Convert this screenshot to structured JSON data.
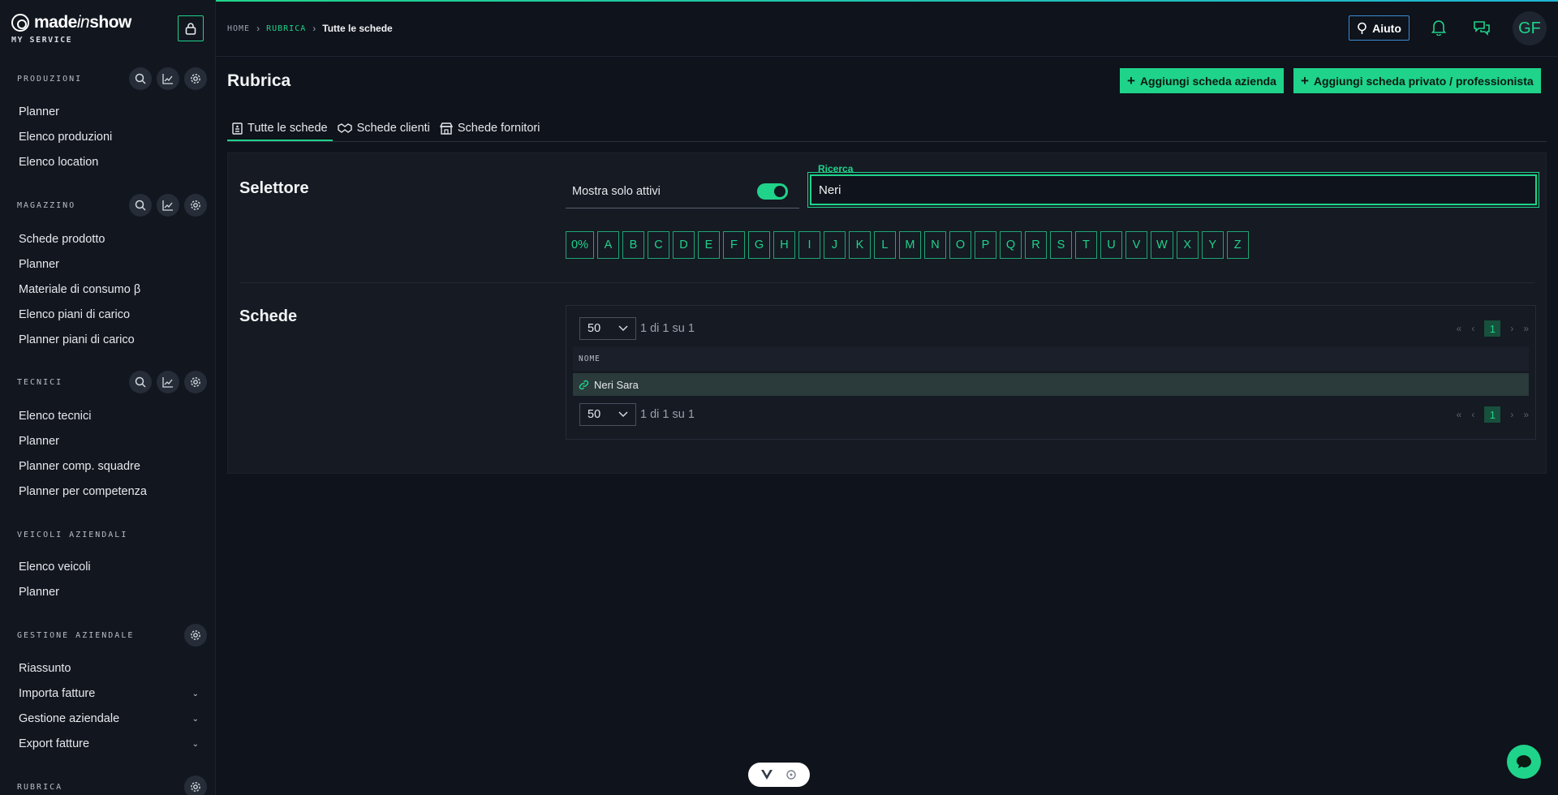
{
  "brand": {
    "name_prefix": "made",
    "name_italic": "in",
    "name_suffix": "show",
    "subtitle": "MY SERVICE"
  },
  "sidebar": {
    "sections": [
      {
        "title": "PRODUZIONI",
        "items": [
          "Planner",
          "Elenco produzioni",
          "Elenco location"
        ]
      },
      {
        "title": "MAGAZZINO",
        "items": [
          "Schede prodotto",
          "Planner",
          "Materiale di consumo β",
          "Elenco piani di carico",
          "Planner piani di carico"
        ]
      },
      {
        "title": "TECNICI",
        "items": [
          "Elenco tecnici",
          "Planner",
          "Planner comp. squadre",
          "Planner per competenza"
        ]
      },
      {
        "title": "VEICOLI AZIENDALI",
        "items": [
          "Elenco veicoli",
          "Planner"
        ]
      },
      {
        "title": "GESTIONE AZIENDALE",
        "items": [
          "Riassunto",
          "Importa fatture",
          "Gestione aziendale",
          "Export fatture"
        ]
      },
      {
        "title": "RUBRICA",
        "items": []
      }
    ]
  },
  "header": {
    "breadcrumb": {
      "home": "HOME",
      "section": "RUBRICA",
      "current": "Tutte le schede"
    },
    "help_label": "Aiuto",
    "avatar_initials": "GF"
  },
  "page": {
    "title": "Rubrica",
    "actions": {
      "add_company": "Aggiungi scheda azienda",
      "add_private": "Aggiungi scheda privato / professionista"
    },
    "tabs": [
      "Tutte le schede",
      "Schede clienti",
      "Schede fornitori"
    ]
  },
  "selector": {
    "title": "Selettore",
    "toggle_label": "Mostra solo attivi",
    "toggle_on": true,
    "search_label": "Ricerca",
    "search_value": "Neri",
    "letters": [
      "0%",
      "A",
      "B",
      "C",
      "D",
      "E",
      "F",
      "G",
      "H",
      "I",
      "J",
      "K",
      "L",
      "M",
      "N",
      "O",
      "P",
      "Q",
      "R",
      "S",
      "T",
      "U",
      "V",
      "W",
      "X",
      "Y",
      "Z"
    ]
  },
  "cards": {
    "title": "Schede",
    "page_size": "50",
    "page_info": "1 di 1 su 1",
    "current_page": "1",
    "column_name": "NOME",
    "rows": [
      "Neri Sara"
    ]
  },
  "colors": {
    "accent": "#1fd38a",
    "background": "#0f131b",
    "sidebar": "#12161f",
    "help_border": "#3d8bd6"
  }
}
